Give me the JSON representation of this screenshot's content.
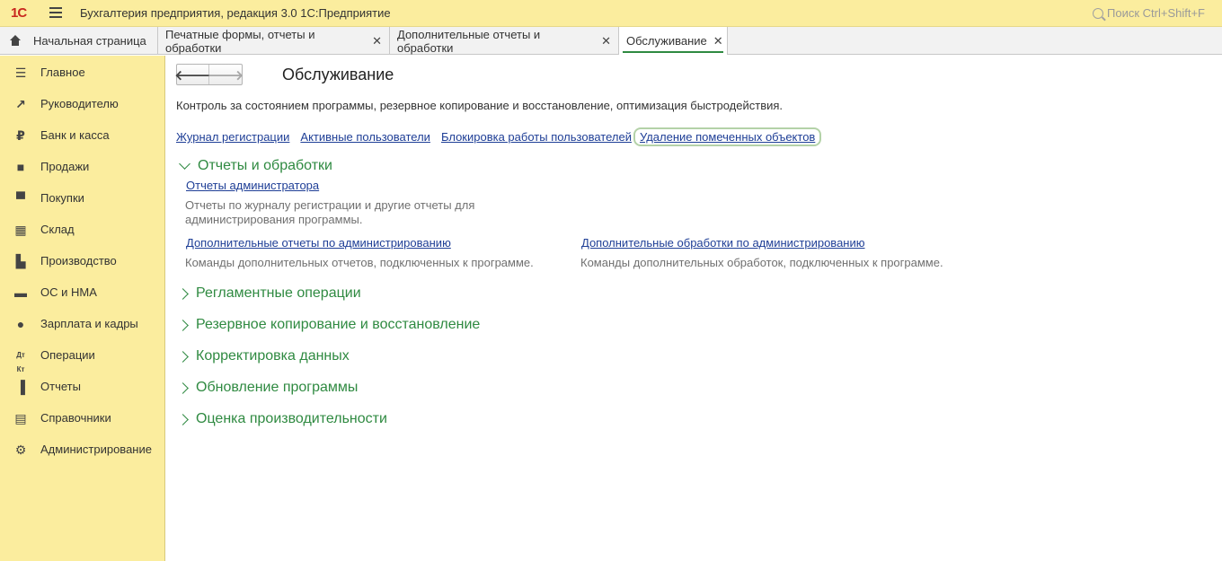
{
  "titlebar": {
    "logo": "1С",
    "app_title": "Бухгалтерия предприятия, редакция 3.0 1С:Предприятие",
    "search_placeholder": "Поиск Ctrl+Shift+F"
  },
  "tabs": [
    {
      "label": "Начальная страница",
      "closable": false,
      "active": false
    },
    {
      "label": "Печатные формы, отчеты и обработки",
      "closable": true,
      "active": false
    },
    {
      "label": "Дополнительные отчеты и обработки",
      "closable": true,
      "active": false
    },
    {
      "label": "Обслуживание",
      "closable": true,
      "active": true
    }
  ],
  "tab_close": "✕",
  "sidebar": {
    "items": [
      {
        "label": "Главное",
        "icon": "list-icon"
      },
      {
        "label": "Руководителю",
        "icon": "trend-icon"
      },
      {
        "label": "Банк и касса",
        "icon": "ruble-icon"
      },
      {
        "label": "Продажи",
        "icon": "bag-icon"
      },
      {
        "label": "Покупки",
        "icon": "cart-icon"
      },
      {
        "label": "Склад",
        "icon": "warehouse-icon"
      },
      {
        "label": "Производство",
        "icon": "factory-icon"
      },
      {
        "label": "ОС и НМА",
        "icon": "truck-icon"
      },
      {
        "label": "Зарплата и кадры",
        "icon": "person-icon"
      },
      {
        "label": "Операции",
        "icon": "dt-kt-icon"
      },
      {
        "label": "Отчеты",
        "icon": "bar-chart-icon"
      },
      {
        "label": "Справочники",
        "icon": "book-icon"
      },
      {
        "label": "Администрирование",
        "icon": "gear-icon"
      }
    ]
  },
  "page": {
    "title": "Обслуживание",
    "description": "Контроль за состоянием программы, резервное копирование и восстановление, оптимизация быстродействия.",
    "top_links": [
      "Журнал регистрации",
      "Активные пользователи",
      "Блокировка работы пользователей",
      "Удаление помеченных объектов"
    ],
    "expanded_group": {
      "title": "Отчеты и обработки",
      "items": [
        {
          "link": "Отчеты администратора",
          "desc": "Отчеты по журналу регистрации и другие отчеты для администрирования программы."
        },
        {
          "link": "Дополнительные отчеты по администрированию",
          "desc": "Команды дополнительных отчетов, подключенных к программе."
        },
        {
          "link": "Дополнительные обработки по администрированию",
          "desc": "Команды дополнительных обработок, подключенных к программе."
        }
      ]
    },
    "collapsed_groups": [
      "Регламентные операции",
      "Резервное копирование и восстановление",
      "Корректировка данных",
      "Обновление программы",
      "Оценка производительности"
    ]
  },
  "colors": {
    "section_green": "#2f8a41",
    "link_blue": "#1e3e96",
    "panel_yellow": "#fbed9e"
  }
}
